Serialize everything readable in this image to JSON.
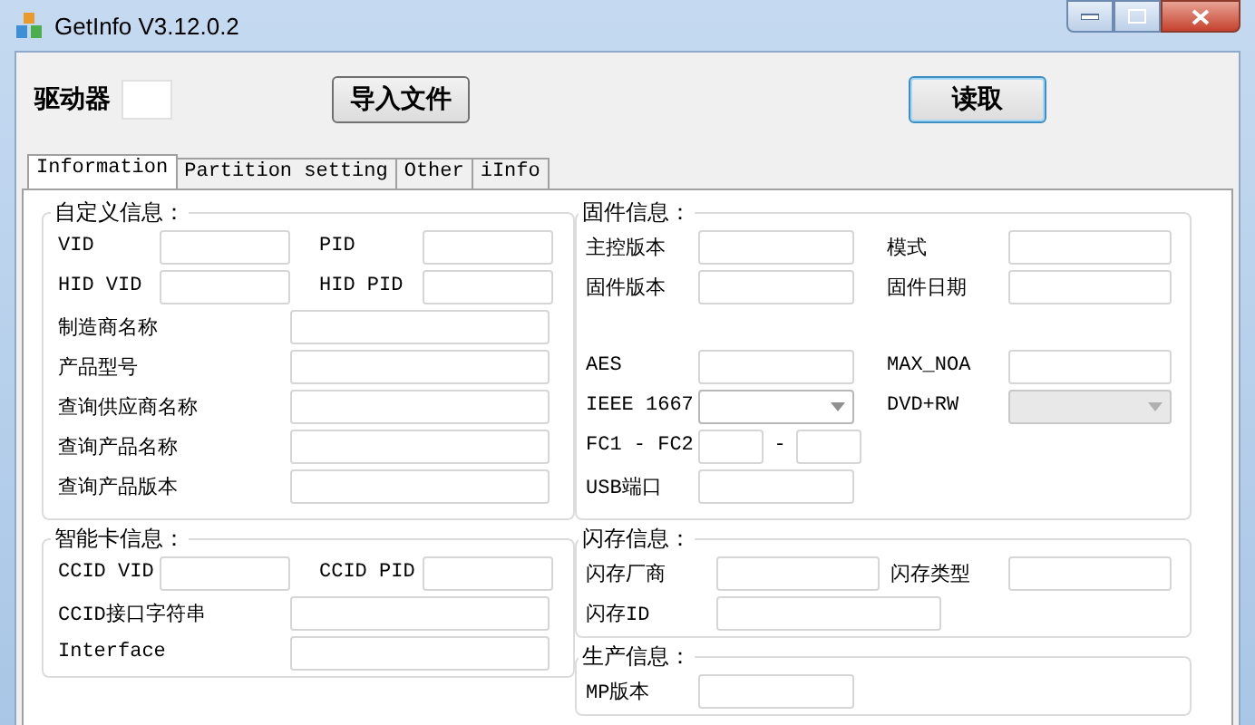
{
  "window": {
    "title": "GetInfo V3.12.0.2"
  },
  "toolbar": {
    "drive_label": "驱动器",
    "import_button": "导入文件",
    "read_button": "读取"
  },
  "tabs": [
    {
      "label": "Information",
      "selected": true
    },
    {
      "label": "Partition setting",
      "selected": false
    },
    {
      "label": "Other",
      "selected": false
    },
    {
      "label": "iInfo",
      "selected": false
    }
  ],
  "columns": [
    {
      "groups": [
        {
          "title": "自定义信息：",
          "rows": [
            {
              "kind": "pair",
              "items": [
                {
                  "label": "VID",
                  "kind": "textbox"
                },
                {
                  "label": "PID",
                  "kind": "textbox"
                }
              ]
            },
            {
              "kind": "pair",
              "items": [
                {
                  "label": "HID VID",
                  "kind": "textbox"
                },
                {
                  "label": "HID PID",
                  "kind": "textbox"
                }
              ]
            },
            {
              "kind": "wide",
              "label": "制造商名称"
            },
            {
              "kind": "wide",
              "label": "产品型号"
            },
            {
              "kind": "wide",
              "label": "查询供应商名称"
            },
            {
              "kind": "wide",
              "label": "查询产品名称"
            },
            {
              "kind": "wide",
              "label": "查询产品版本"
            }
          ]
        },
        {
          "title": "智能卡信息：",
          "rows": [
            {
              "kind": "pair",
              "items": [
                {
                  "label": "CCID VID",
                  "kind": "textbox"
                },
                {
                  "label": "CCID PID",
                  "kind": "textbox"
                }
              ]
            },
            {
              "kind": "wide",
              "label": "CCID接口字符串"
            },
            {
              "kind": "wide",
              "label": "Interface"
            }
          ]
        }
      ]
    },
    {
      "groups": [
        {
          "title": "固件信息：",
          "rows": [
            {
              "kind": "pair",
              "items": [
                {
                  "label": "主控版本",
                  "kind": "textbox"
                },
                {
                  "label": "模式",
                  "kind": "textbox"
                }
              ]
            },
            {
              "kind": "pair",
              "items": [
                {
                  "label": "固件版本",
                  "kind": "textbox"
                },
                {
                  "label": "固件日期",
                  "kind": "textbox"
                }
              ]
            },
            {
              "kind": "pair",
              "items": [
                {
                  "label": "AES",
                  "kind": "textbox"
                },
                {
                  "label": "MAX_NOA",
                  "kind": "textbox"
                }
              ]
            },
            {
              "kind": "pair",
              "items": [
                {
                  "label": "IEEE 1667",
                  "kind": "combo",
                  "disabled": false
                },
                {
                  "label": "DVD+RW",
                  "kind": "combo",
                  "disabled": true
                }
              ]
            },
            {
              "kind": "range",
              "label": "FC1 - FC2",
              "separator": "-"
            },
            {
              "kind": "single",
              "label": "USB端口"
            }
          ]
        },
        {
          "title": "闪存信息：",
          "rows": [
            {
              "kind": "pair",
              "items": [
                {
                  "label": "闪存厂商",
                  "kind": "textbox"
                },
                {
                  "label": "闪存类型",
                  "kind": "textbox"
                }
              ]
            },
            {
              "kind": "single",
              "label": "闪存ID"
            }
          ]
        },
        {
          "title": "生产信息：",
          "rows": [
            {
              "kind": "single",
              "label": "MP版本"
            }
          ]
        }
      ]
    }
  ]
}
